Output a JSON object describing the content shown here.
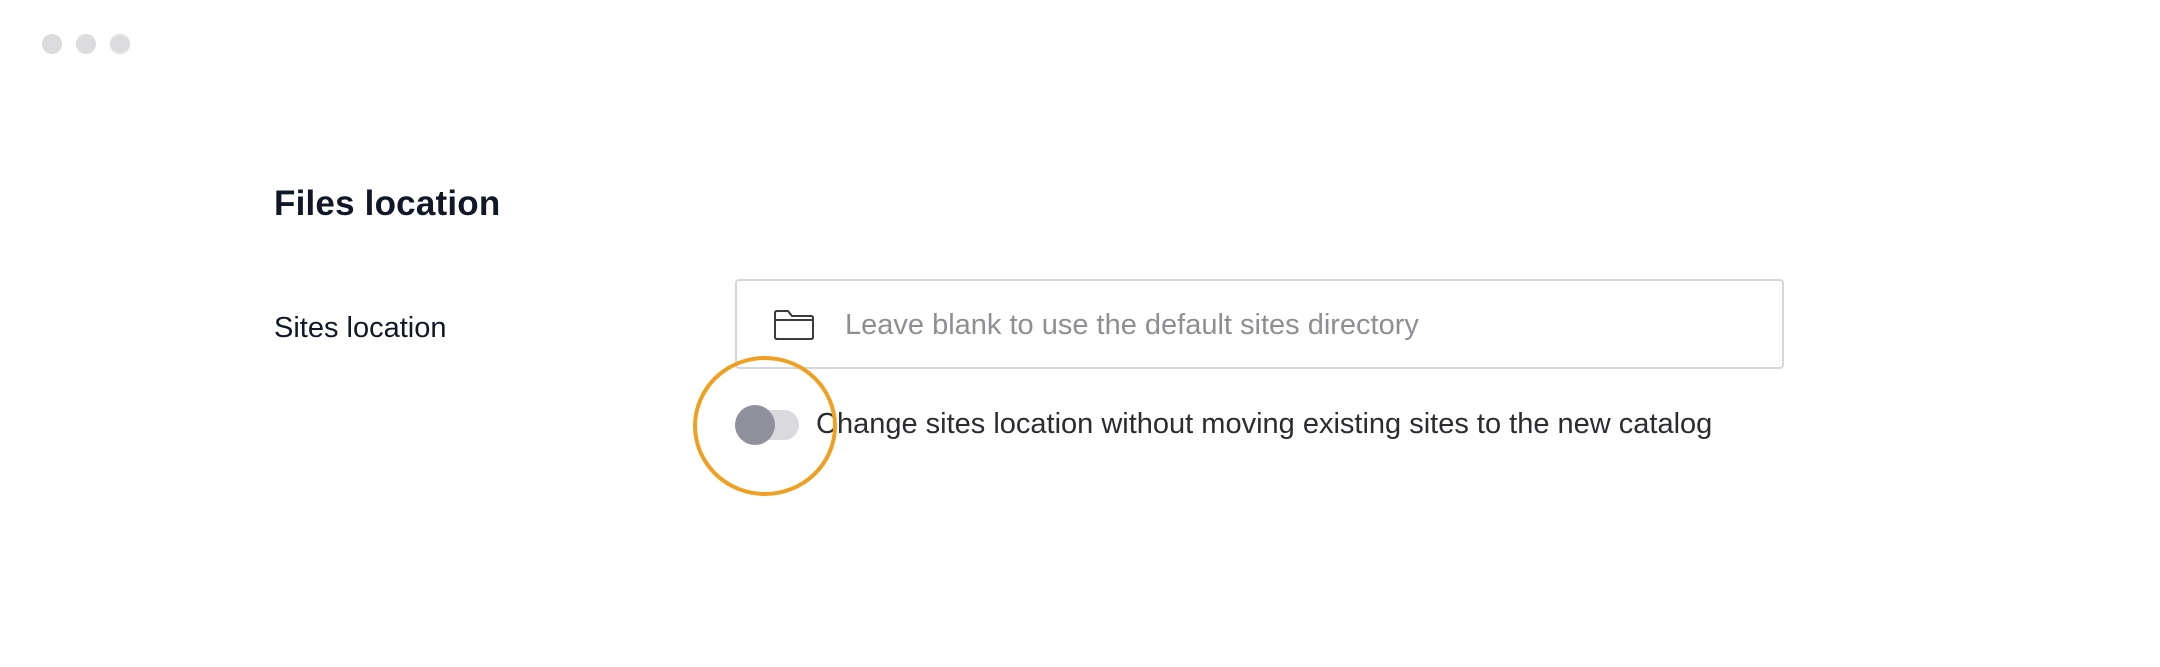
{
  "window": {
    "controls": [
      "close",
      "minimize",
      "zoom"
    ]
  },
  "section": {
    "title": "Files location"
  },
  "sites_location": {
    "label": "Sites location",
    "value": "",
    "placeholder": "Leave blank to use the default sites directory",
    "icon": "folder-icon"
  },
  "move_toggle": {
    "label": "Change sites location without moving existing sites to the new catalog",
    "checked": false
  },
  "colors": {
    "highlight_ring": "#f0a020",
    "toggle_knob": "#8f909c",
    "toggle_track": "#d9d9de",
    "placeholder_text": "#8e8e93"
  }
}
